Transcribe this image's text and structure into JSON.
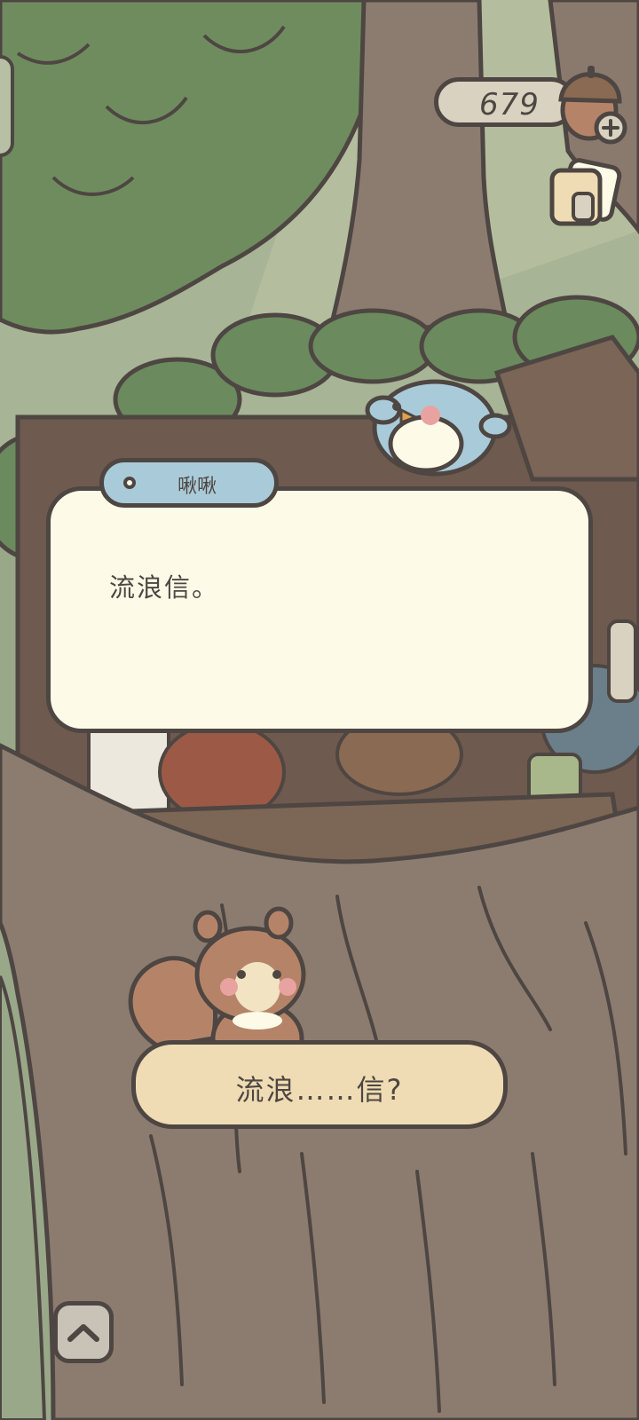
{
  "hud": {
    "acorn_count": "679",
    "acorn_icon": "acorn-plus-icon",
    "album_icon": "photo-album-icon"
  },
  "dialog": {
    "speaker": "啾啾",
    "text": "流浪信。"
  },
  "choice": {
    "label": "流浪……信?"
  },
  "controls": {
    "expand_icon": "chevron-up-icon"
  },
  "colors": {
    "outline": "#4e4642",
    "dialog_bg": "#fdfbe8",
    "speaker_tag": "#a9cbd9",
    "choice_bg": "#efdcb4",
    "tree_bark": "#8c7c70",
    "foliage": "#6b8a5e"
  }
}
